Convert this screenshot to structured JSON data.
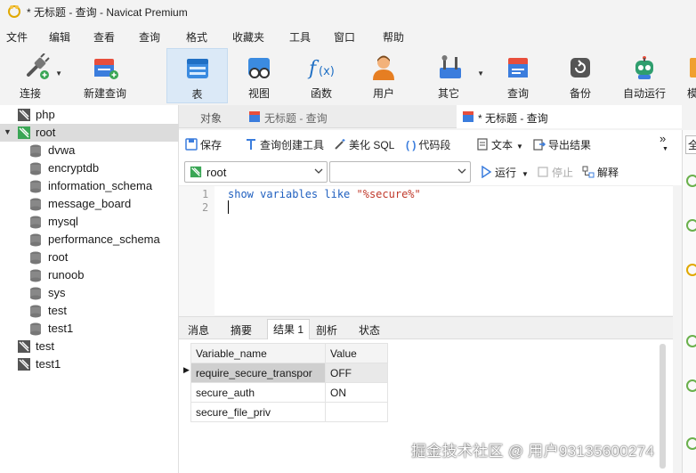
{
  "window": {
    "title": "* 无标题 - 查询 - Navicat Premium"
  },
  "menu": [
    "文件",
    "编辑",
    "查看",
    "查询",
    "格式",
    "收藏夹",
    "工具",
    "窗口",
    "帮助"
  ],
  "toolbar": {
    "connect": "连接",
    "new_query": "新建查询",
    "table": "表",
    "view": "视图",
    "function": "函数",
    "user": "用户",
    "other": "其它",
    "query": "查询",
    "backup": "备份",
    "auto_run": "自动运行",
    "cut_off": "模"
  },
  "tree": {
    "connections": [
      {
        "label": "php"
      },
      {
        "label": "root"
      },
      {
        "label": "test"
      },
      {
        "label": "test1"
      }
    ],
    "databases": [
      "dvwa",
      "encryptdb",
      "information_schema",
      "message_board",
      "mysql",
      "performance_schema",
      "root",
      "runoob",
      "sys",
      "test",
      "test1"
    ]
  },
  "tabs": {
    "objects": "对象",
    "tab1": "无标题 - 查询",
    "tab2": "* 无标题 - 查询"
  },
  "query_toolbar": {
    "save": "保存",
    "builder": "查询创建工具",
    "beautify": "美化 SQL",
    "snippet": "代码段",
    "text": "文本",
    "export": "导出结果",
    "more": "»"
  },
  "selectors": {
    "connection": "root",
    "database": "",
    "run": "运行",
    "stop": "停止",
    "explain": "解释"
  },
  "editor": {
    "line_numbers": [
      "1",
      "2"
    ],
    "kw1": "show variables like ",
    "str": "\"%secure%\""
  },
  "result_tabs": [
    "消息",
    "摘要",
    "结果 1",
    "剖析",
    "状态"
  ],
  "results": {
    "columns": [
      "Variable_name",
      "Value"
    ],
    "rows": [
      [
        "require_secure_transpor",
        "OFF"
      ],
      [
        "secure_auth",
        "ON"
      ],
      [
        "secure_file_priv",
        ""
      ]
    ]
  },
  "right_panel": {
    "label": "全"
  },
  "watermark": "掘金技术社区 @ 用户93135600274",
  "colors": {
    "selected_tool": "#dbe9f7",
    "connection_green": "#3aa655",
    "keyword": "#1f5fbf",
    "string": "#c0392b"
  }
}
